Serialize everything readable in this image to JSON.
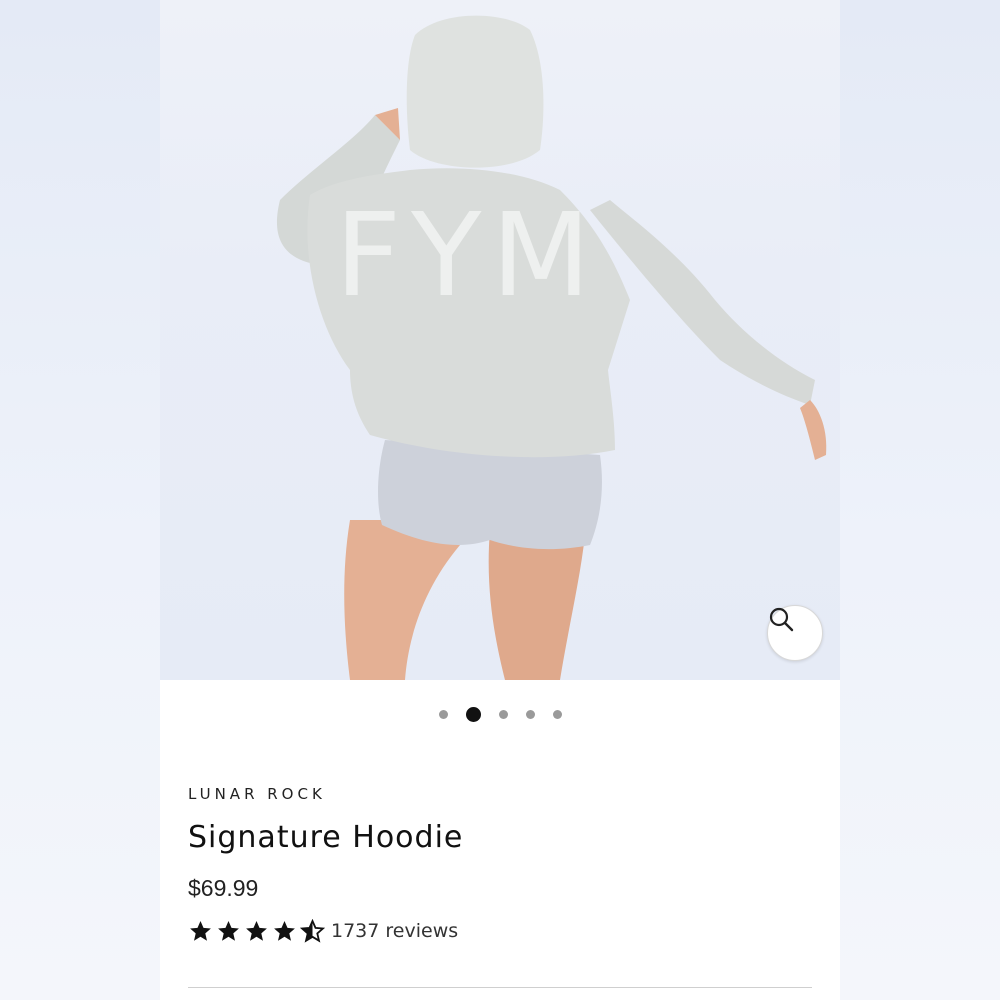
{
  "product": {
    "vendor": "LUNAR ROCK",
    "title": "Signature Hoodie",
    "price": "$69.99",
    "rating_value": 4.5,
    "rating_max": 5,
    "reviews_text": "1737 reviews"
  },
  "gallery": {
    "image_alt": "Model wearing oversized light grey hoodie with large FYM back print and grey shorts",
    "print_text": "FYM",
    "image_count": 5,
    "active_index": 1,
    "zoom_icon": "search-icon"
  },
  "colors": {
    "hoodie": "#d9dcda",
    "shorts": "#cdd1da",
    "skin": "#e4b094",
    "star": "#111111",
    "active_dot": "#111111",
    "inactive_dot": "#9a9a9a"
  }
}
